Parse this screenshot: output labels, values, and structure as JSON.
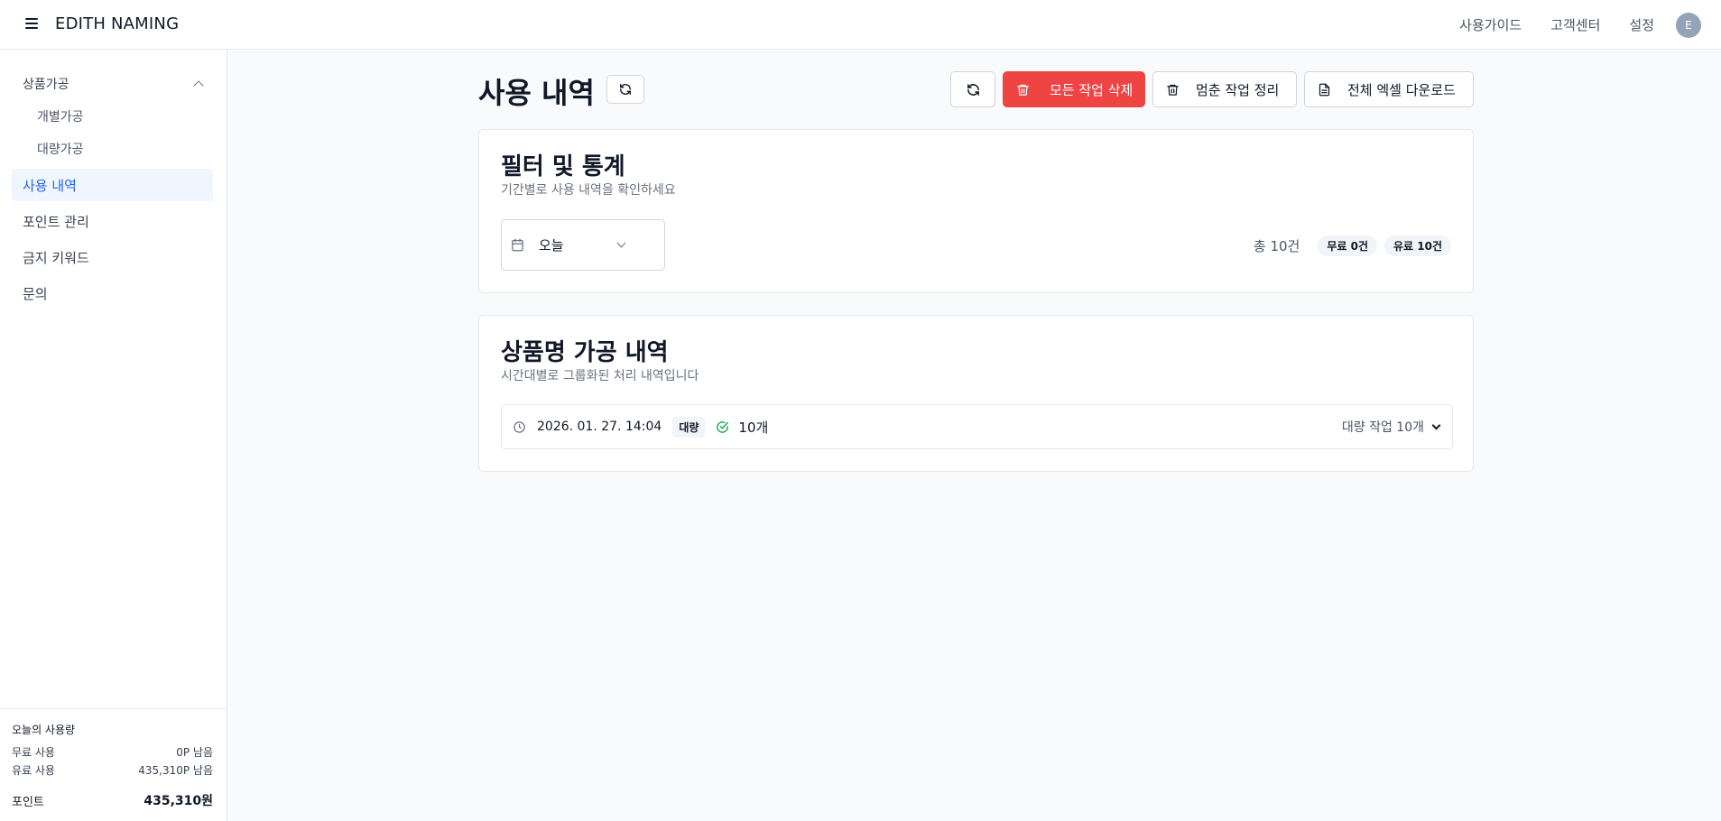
{
  "header": {
    "app_title": "EDITH NAMING",
    "links": [
      "사용가이드",
      "고객센터",
      "설정"
    ],
    "avatar_initial": "E"
  },
  "sidebar": {
    "group_label": "상품가공",
    "sub_items": [
      "개별가공",
      "대량가공"
    ],
    "items": [
      "사용 내역",
      "포인트 관리",
      "금지 키워드",
      "문의"
    ],
    "active_item": "사용 내역"
  },
  "usage": {
    "title": "오늘의 사용량",
    "free_label": "무료 사용",
    "free_value": "0P 남음",
    "paid_label": "유료 사용",
    "paid_value": "435,310P 남음",
    "points_label": "포인트",
    "points_value": "435,310원"
  },
  "page": {
    "title": "사용 내역"
  },
  "toolbar": {
    "delete_all_label": "모든 작업 삭제",
    "clean_stuck_label": "멈춘 작업 정리",
    "excel_download_label": "전체 엑셀 다운로드"
  },
  "filter_card": {
    "title": "필터 및 통계",
    "subtitle": "기간별로 사용 내역을 확인하세요",
    "period_selected": "오늘",
    "total": "총 10건",
    "free_badge": "무료 0건",
    "paid_badge": "유료 10건"
  },
  "history_card": {
    "title": "상품명 가공 내역",
    "subtitle": "시간대별로 그룹화된 처리 내역입니다",
    "rows": [
      {
        "datetime": "2026. 01. 27. 14:04",
        "type_tag": "대량",
        "count": "10개",
        "summary": "대량 작업 10개"
      }
    ]
  },
  "colors": {
    "accent": "#2563eb",
    "danger": "#ef4444",
    "success": "#16a34a"
  }
}
